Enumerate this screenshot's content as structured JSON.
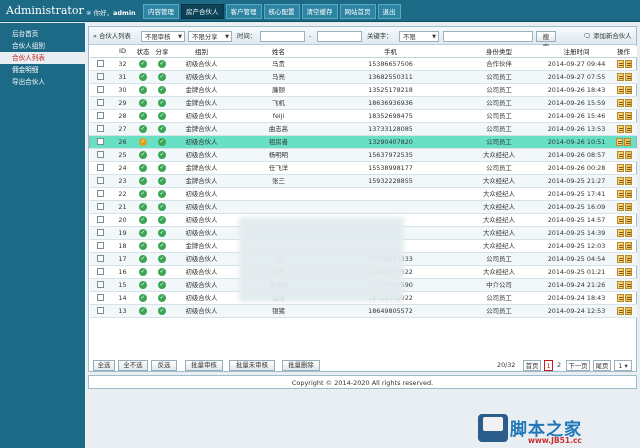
{
  "header": {
    "brand": "Administrator",
    "greeting_prefix": "※ 你好，",
    "user": "admin",
    "tabs": [
      "内容管理",
      "房产合伙人",
      "客户管理",
      "核心配置",
      "清空缓存",
      "网站首页",
      "退出"
    ],
    "active_tab": 1
  },
  "sidebar": {
    "items": [
      "后台首页",
      "合伙人组别",
      "合伙人列表",
      "佣金明细",
      "导出合伙人"
    ],
    "active_item": 2
  },
  "filters": {
    "list_label": "» 合伙人列表",
    "review": "不限审核",
    "share": "不限分享",
    "time_label": "时间：",
    "time_sep": "-",
    "keyword_label": "关键字：",
    "keyword_scope": "不限",
    "search_button": "搜索",
    "add_new": "添加新合伙人"
  },
  "table": {
    "headers": [
      "ID",
      "状态",
      "分享",
      "组别",
      "姓名",
      "手机",
      "身份类型",
      "注册时间",
      "操作"
    ],
    "rows": [
      {
        "id": "32",
        "group": "初级合伙人",
        "name": "马贵",
        "phone": "15386657506",
        "type": "合作伙伴",
        "time": "2014-09-27 09:44"
      },
      {
        "id": "31",
        "group": "初级合伙人",
        "name": "马亮",
        "phone": "13682550311",
        "type": "公司员工",
        "time": "2014-09-27 07:55"
      },
      {
        "id": "30",
        "group": "金牌合伙人",
        "name": "廉颐",
        "phone": "13525178218",
        "type": "公司员工",
        "time": "2014-09-26 18:43"
      },
      {
        "id": "29",
        "group": "金牌合伙人",
        "name": "飞机",
        "phone": "18636936936",
        "type": "公司员工",
        "time": "2014-09-26 15:59"
      },
      {
        "id": "28",
        "group": "初级合伙人",
        "name": "feiji",
        "phone": "18352698475",
        "type": "公司员工",
        "time": "2014-09-26 15:46"
      },
      {
        "id": "27",
        "group": "金牌合伙人",
        "name": "曲志高",
        "phone": "13733128085",
        "type": "公司员工",
        "time": "2014-09-26 13:53"
      },
      {
        "id": "26",
        "group": "初级合伙人",
        "name": "祖房者",
        "phone": "13290407820",
        "type": "公司员工",
        "time": "2014-09-26 10:51"
      },
      {
        "id": "25",
        "group": "初级合伙人",
        "name": "杨明明",
        "phone": "15637972535",
        "type": "大众经纪人",
        "time": "2014-09-26 08:57"
      },
      {
        "id": "24",
        "group": "金牌合伙人",
        "name": "任飞洋",
        "phone": "15538998177",
        "type": "公司员工",
        "time": "2014-09-26 00:28"
      },
      {
        "id": "23",
        "group": "金牌合伙人",
        "name": "张三",
        "phone": "15932228855",
        "type": "大众经纪人",
        "time": "2014-09-25 21:27"
      },
      {
        "id": "22",
        "group": "初级合伙人",
        "name": "",
        "phone": "",
        "type": "大众经纪人",
        "time": "2014-09-25 17:41"
      },
      {
        "id": "21",
        "group": "初级合伙人",
        "name": "",
        "phone": "",
        "type": "大众经纪人",
        "time": "2014-09-25 16:09"
      },
      {
        "id": "20",
        "group": "初级合伙人",
        "name": "",
        "phone": "",
        "type": "大众经纪人",
        "time": "2014-09-25 14:57"
      },
      {
        "id": "19",
        "group": "初级合伙人",
        "name": "",
        "phone": "",
        "type": "大众经纪人",
        "time": "2014-09-25 14:39"
      },
      {
        "id": "18",
        "group": "金牌合伙人",
        "name": "",
        "phone": "",
        "type": "大众经纪人",
        "time": "2014-09-25 12:03"
      },
      {
        "id": "17",
        "group": "初级合伙人",
        "name": "jjjj",
        "phone": "15566663333",
        "type": "公司员工",
        "time": "2014-09-25 04:54"
      },
      {
        "id": "16",
        "group": "初级合伙人",
        "name": "饭否",
        "phone": "13645887522",
        "type": "大众经纪人",
        "time": "2014-09-25 01:21"
      },
      {
        "id": "15",
        "group": "初级合伙人",
        "name": "李营博",
        "phone": "15151629590",
        "type": "中介公司",
        "time": "2014-09-24 21:26"
      },
      {
        "id": "14",
        "group": "初级合伙人",
        "name": "张琳",
        "phone": "18720302922",
        "type": "公司员工",
        "time": "2014-09-24 18:43"
      },
      {
        "id": "13",
        "group": "初级合伙人",
        "name": "银猪",
        "phone": "18649805572",
        "type": "公司员工",
        "time": "2014-09-24 12:53"
      }
    ],
    "selected_row": 6
  },
  "footer_buttons": [
    "全选",
    "全不选",
    "反选",
    "批量审核",
    "批量未审核",
    "批量删除"
  ],
  "pagination": {
    "count": "20/32",
    "first": "首页",
    "current": "1",
    "next_num": "2",
    "next": "下一页",
    "last": "尾页",
    "select": "1"
  },
  "copyright": "Copyright © 2014-2020 All rights reserved.",
  "watermark": {
    "text": "脚本之家",
    "url": "www.JB51.cc"
  }
}
